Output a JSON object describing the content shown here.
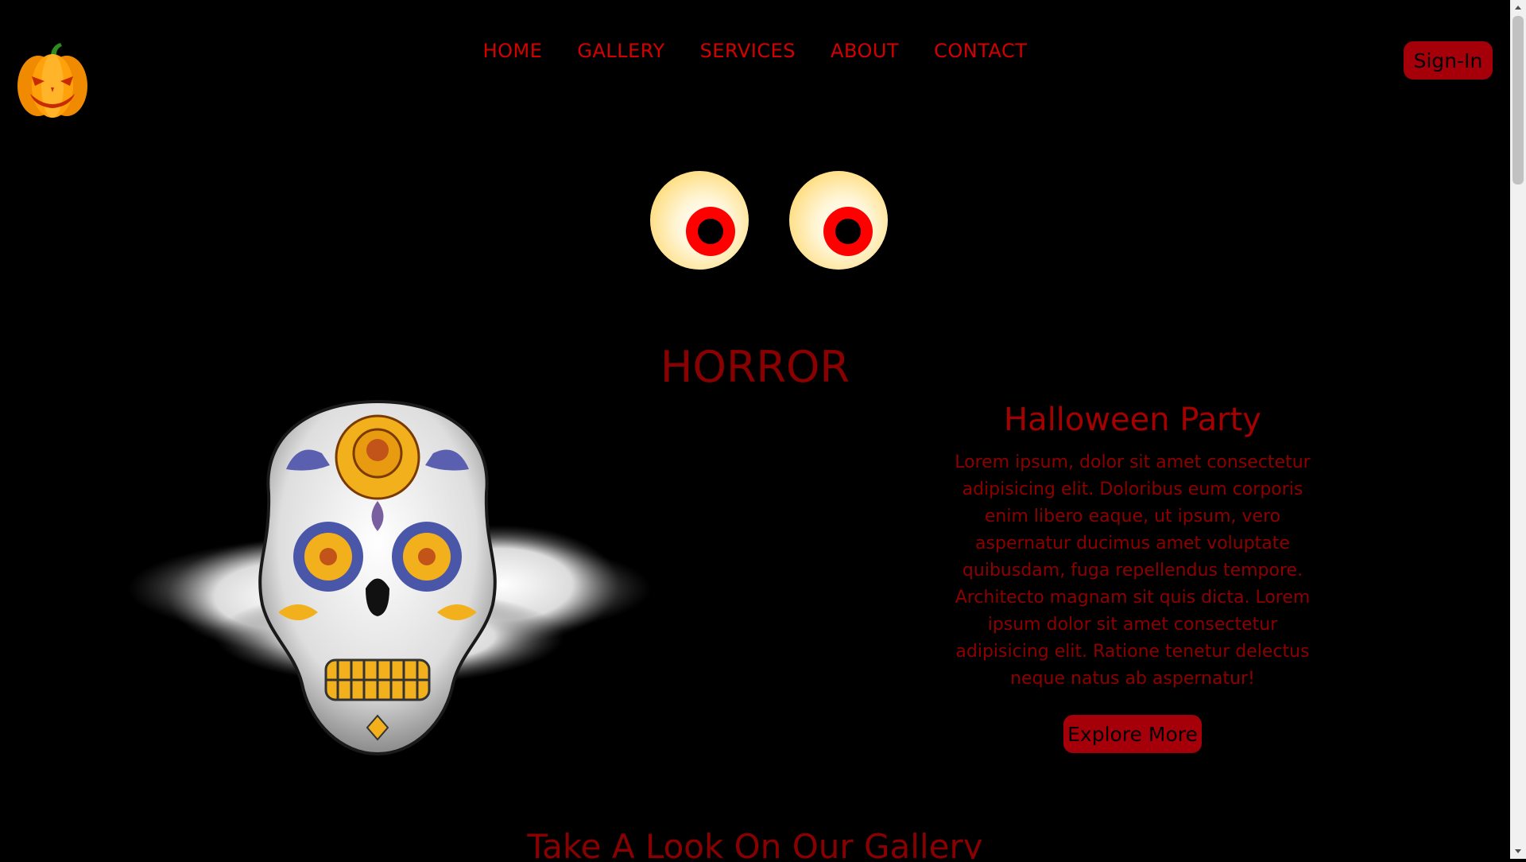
{
  "header": {
    "logo_icon": "jack-o-lantern-icon",
    "nav": [
      "HOME",
      "GALLERY",
      "SERVICES",
      "ABOUT",
      "CONTACT"
    ],
    "signin_label": "Sign-In"
  },
  "hero": {
    "title": "HORROR",
    "eyes_icon": "glowing-eyes"
  },
  "party": {
    "heading": "Halloween Party",
    "body": "Lorem ipsum, dolor sit amet consectetur adipisicing elit. Doloribus eum corporis enim libero eaque, ut ipsum, vero aspernatur ducimus amet voluptate quibusdam, fuga repellendus tempore. Architecto magnam sit quis dicta. Lorem ipsum dolor sit amet consectetur adipisicing elit. Ratione tenetur delectus neque natus ab aspernatur!",
    "button_label": "Explore More",
    "image": "sugar-skull-on-cloud"
  },
  "gallery": {
    "title": "Take A Look On Our Gallery"
  },
  "colors": {
    "accent": "#d40000",
    "button": "#a5000a",
    "background": "#000000"
  }
}
